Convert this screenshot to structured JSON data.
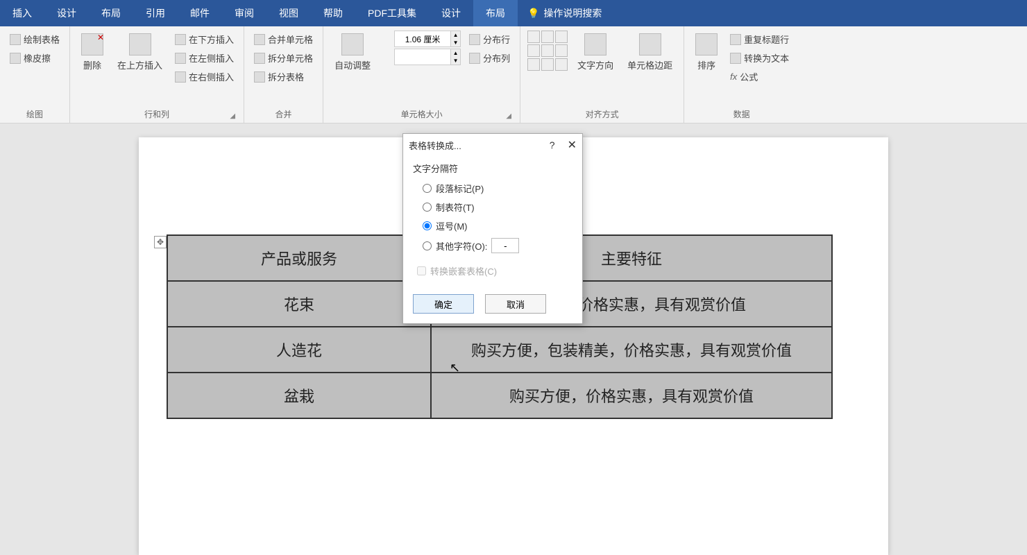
{
  "menubar": {
    "tabs": [
      "插入",
      "设计",
      "布局",
      "引用",
      "邮件",
      "审阅",
      "视图",
      "帮助",
      "PDF工具集",
      "设计",
      "布局"
    ],
    "active_index": 10,
    "tell_me": "操作说明搜索"
  },
  "ribbon": {
    "draw": {
      "label": "绘图",
      "draw_table": "绘制表格",
      "eraser": "橡皮擦"
    },
    "rows_cols": {
      "label": "行和列",
      "delete": "删除",
      "insert_above": "在上方插入",
      "insert_below": "在下方插入",
      "insert_left": "在左侧插入",
      "insert_right": "在右侧插入"
    },
    "merge": {
      "label": "合并",
      "merge_cells": "合并单元格",
      "split_cells": "拆分单元格",
      "split_table": "拆分表格"
    },
    "cell_size": {
      "label": "单元格大小",
      "autofit": "自动调整",
      "height_value": "1.06 厘米",
      "distribute_rows": "分布行",
      "distribute_cols": "分布列"
    },
    "alignment": {
      "label": "对齐方式",
      "text_direction": "文字方向",
      "cell_margins": "单元格边距"
    },
    "data": {
      "label": "数据",
      "sort": "排序",
      "repeat_header": "重复标题行",
      "convert_to_text": "转换为文本",
      "formula": "公式"
    }
  },
  "doc_table": {
    "headers": [
      "产品或服务",
      "主要特征"
    ],
    "rows": [
      [
        "花束",
        "装精美，价格实惠，具有观赏价值"
      ],
      [
        "人造花",
        "购买方便，包装精美，价格实惠，具有观赏价值"
      ],
      [
        "盆栽",
        "购买方便，价格实惠，具有观赏价值"
      ]
    ]
  },
  "dialog": {
    "title": "表格转换成...",
    "section": "文字分隔符",
    "options": {
      "paragraph": "段落标记(P)",
      "tab": "制表符(T)",
      "comma": "逗号(M)",
      "other": "其他字符(O):"
    },
    "other_value": "-",
    "selected": "comma",
    "nested": "转换嵌套表格(C)",
    "ok": "确定",
    "cancel": "取消"
  }
}
